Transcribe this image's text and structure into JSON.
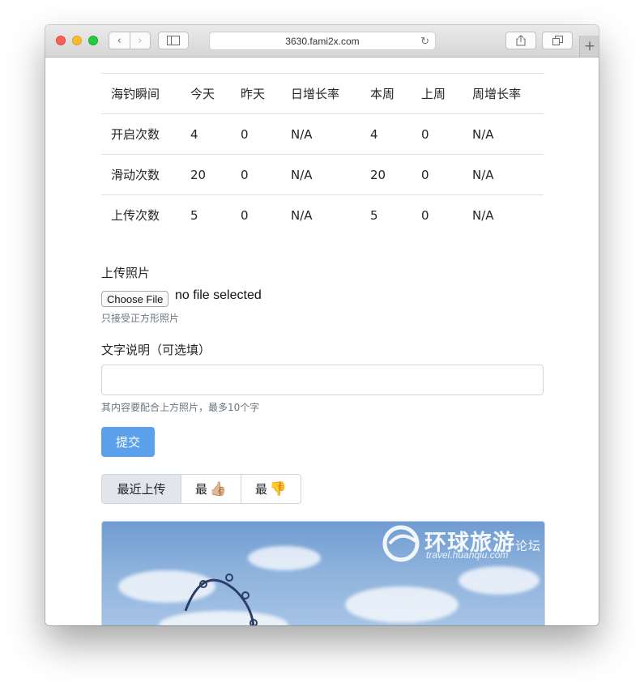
{
  "browser": {
    "url": "3630.fami2x.com",
    "back_glyph": "‹",
    "forward_glyph": "›",
    "new_tab_glyph": "+"
  },
  "stats_table": {
    "headers": [
      "海钓瞬间",
      "今天",
      "昨天",
      "日增长率",
      "本周",
      "上周",
      "周增长率"
    ],
    "rows": [
      [
        "开启次数",
        "4",
        "0",
        "N/A",
        "4",
        "0",
        "N/A"
      ],
      [
        "滑动次数",
        "20",
        "0",
        "N/A",
        "20",
        "0",
        "N/A"
      ],
      [
        "上传次数",
        "5",
        "0",
        "N/A",
        "5",
        "0",
        "N/A"
      ]
    ]
  },
  "upload_form": {
    "photo_label": "上传照片",
    "choose_file_label": "Choose File",
    "file_status": "no file selected",
    "photo_help": "只接受正方形照片",
    "caption_label": "文字说明（可选填）",
    "caption_value": "",
    "caption_help": "其内容要配合上方照片，最多10个字",
    "submit_label": "提交"
  },
  "sort_tabs": {
    "recent": "最近上传",
    "best": "最",
    "best_emoji": "👍🏼",
    "worst": "最",
    "worst_emoji": "👎"
  },
  "photo_watermark": {
    "title": "环球旅游",
    "title_suffix": "论坛",
    "subtitle": "travel.huanqiu.com"
  },
  "icons": [
    "share-icon",
    "tabs-icon",
    "sidebar-icon",
    "reload-icon"
  ],
  "colors": {
    "submit_bg": "#5ba0ea",
    "active_tab_bg": "#e2e6ea",
    "sky": "#8fb3dd"
  }
}
